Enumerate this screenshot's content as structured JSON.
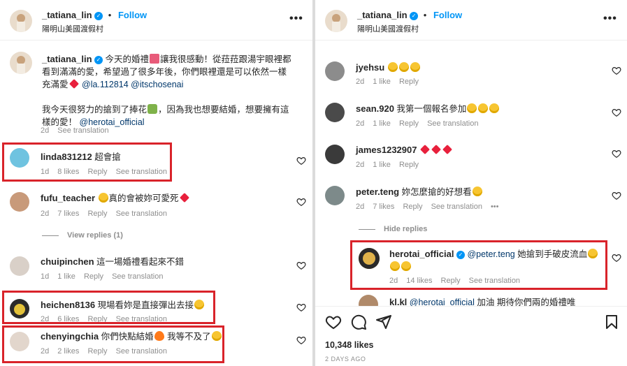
{
  "post": {
    "author": "_tatiana_lin",
    "follow_label": "Follow",
    "location": "陽明山美國渡假村",
    "more_label": "•••",
    "caption": {
      "username": "_tatiana_lin",
      "line1": "今天的婚禮",
      "line1b": "讓我很感動！從菈菈跟湯宇眼裡都",
      "line2": "看到滿滿的愛，希望過了很多年後，你們眼裡還是可以依然一樣",
      "line3": "充滿愛",
      "mention1": "@la.112814",
      "mention2": "@itschosenai",
      "line4": "我今天很努力的搶到了捧花",
      "line4b": "，因為我也想要結婚，想要擁有這",
      "line5": "樣的愛！",
      "mention3": "@herotai_official",
      "time": "2d",
      "see_translation": "See translation"
    },
    "likes_count": "10,348 likes",
    "posted_ago": "2 DAYS AGO"
  },
  "left_comments": [
    {
      "username": "linda831212",
      "text": "超會搶",
      "time": "1d",
      "likes": "8 likes",
      "reply": "Reply",
      "translate": "See translation"
    },
    {
      "username": "fufu_teacher",
      "text": "真的會被妳可愛死",
      "time": "2d",
      "likes": "7 likes",
      "reply": "Reply",
      "translate": "See translation",
      "view_replies": "View replies (1)"
    },
    {
      "username": "chuipinchen",
      "text": "這一場婚禮看起來不錯",
      "time": "1d",
      "likes": "1 like",
      "reply": "Reply",
      "translate": "See translation"
    },
    {
      "username": "heichen8136",
      "text": "現場看妳是直接彈出去接",
      "time": "2d",
      "likes": "6 likes",
      "reply": "Reply",
      "translate": "See translation"
    },
    {
      "username": "chenyingchia",
      "text": "你們快點結婚",
      "text2": "我等不及了",
      "time": "2d",
      "likes": "2 likes",
      "reply": "Reply",
      "translate": "See translation"
    }
  ],
  "right_comments": [
    {
      "username": "jyehsu",
      "text": "",
      "time": "2d",
      "likes": "1 like",
      "reply": "Reply"
    },
    {
      "username": "sean.920",
      "text": "我第一個報名參加",
      "time": "2d",
      "likes": "1 like",
      "reply": "Reply",
      "translate": "See translation"
    },
    {
      "username": "james1232907",
      "text": "",
      "time": "2d",
      "likes": "1 like",
      "reply": "Reply"
    },
    {
      "username": "peter.teng",
      "text": "妳怎麼搶的好想看",
      "time": "2d",
      "likes": "7 likes",
      "reply": "Reply",
      "translate": "See translation",
      "more": "•••",
      "hide_replies": "Hide replies"
    },
    {
      "username": "herotai_official",
      "mention": "@peter.teng",
      "text": "她搶到手破皮流血",
      "time": "2d",
      "likes": "14 likes",
      "reply": "Reply",
      "translate": "See translation"
    },
    {
      "username": "kl.kl",
      "mention": "@herotai_official",
      "text": "加油 期待你們兩的婚禮唯"
    }
  ],
  "colors": {
    "highlight": "#d9232a",
    "link": "#0095f6",
    "muted": "#8e8e8e",
    "mention": "#00376b"
  }
}
